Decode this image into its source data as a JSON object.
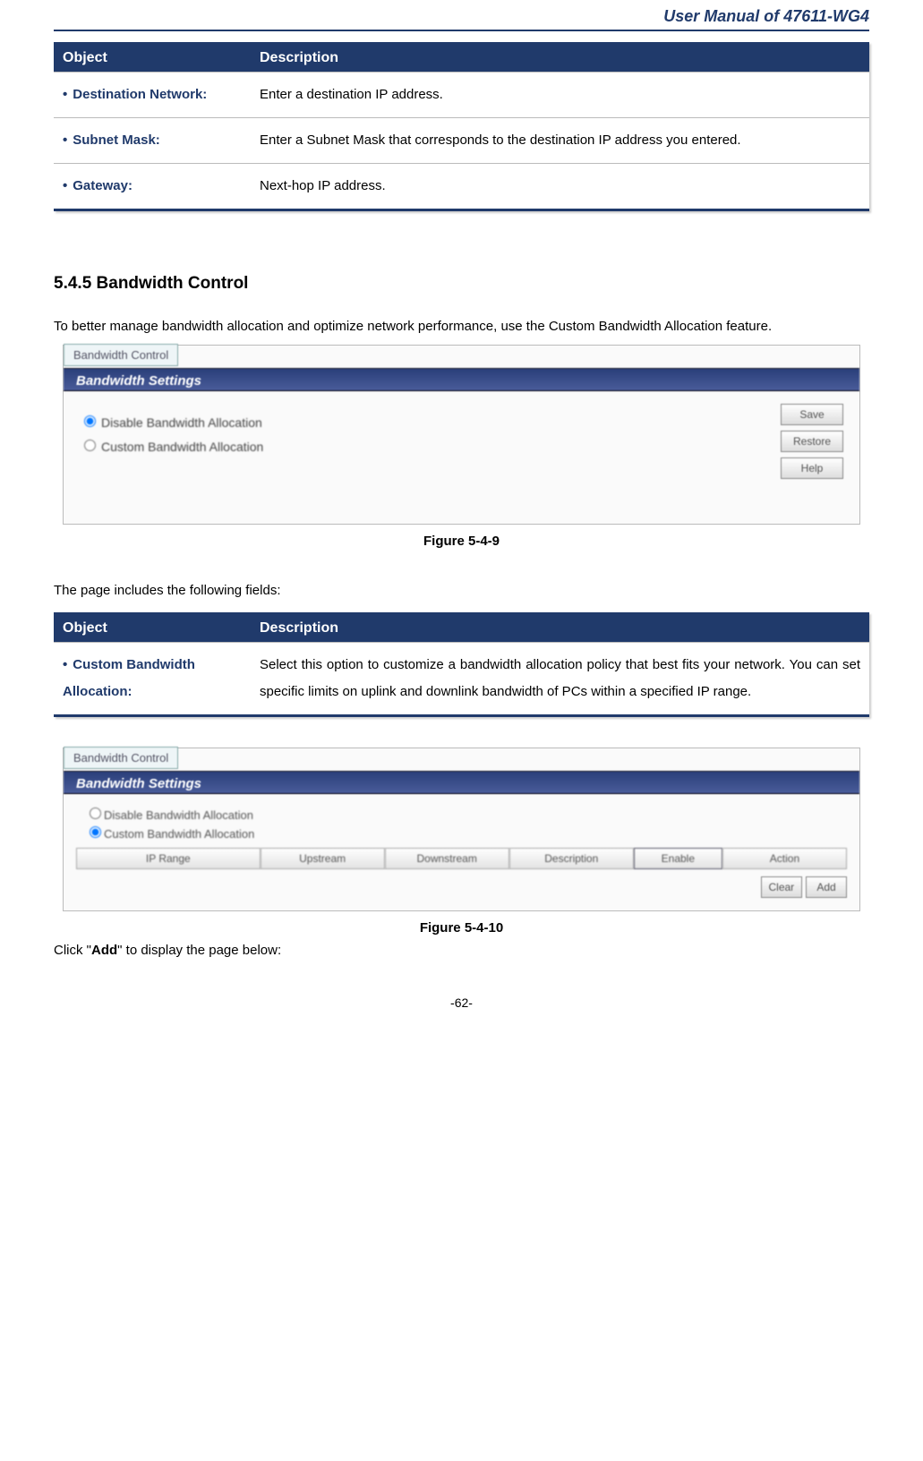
{
  "header": {
    "title": "User Manual of 47611-WG4"
  },
  "table1": {
    "headers": {
      "object": "Object",
      "description": "Description"
    },
    "rows": [
      {
        "object": "Destination Network:",
        "description": "Enter a destination IP address."
      },
      {
        "object": "Subnet Mask:",
        "description": "Enter a Subnet Mask that corresponds to the destination IP address you entered."
      },
      {
        "object": "Gateway:",
        "description": "Next-hop IP address."
      }
    ]
  },
  "section": {
    "heading": "5.4.5   Bandwidth Control",
    "intro": "To better manage bandwidth allocation and optimize network performance, use the Custom Bandwidth Allocation feature."
  },
  "screenshot1": {
    "tab": "Bandwidth Control",
    "titlebar": "Bandwidth Settings",
    "radio_disable": "Disable Bandwidth Allocation",
    "radio_custom": "Custom Bandwidth Allocation",
    "radio_disable_checked": true,
    "radio_custom_checked": false,
    "btn_save": "Save",
    "btn_restore": "Restore",
    "btn_help": "Help"
  },
  "fig1": {
    "caption": "Figure 5-4-9"
  },
  "para2": "The page includes the following fields:",
  "table2": {
    "headers": {
      "object": "Object",
      "description": "Description"
    },
    "rows": [
      {
        "object": "Custom Bandwidth Allocation:",
        "description": "Select this option to customize a bandwidth allocation policy that best fits your network. You can set specific limits on uplink and downlink bandwidth of PCs within a specified IP range."
      }
    ]
  },
  "screenshot2": {
    "tab": "Bandwidth Control",
    "titlebar": "Bandwidth Settings",
    "radio_disable": "Disable Bandwidth Allocation",
    "radio_custom": "Custom Bandwidth Allocation",
    "radio_disable_checked": false,
    "radio_custom_checked": true,
    "cols": [
      "IP Range",
      "Upstream",
      "Downstream",
      "Description",
      "Enable",
      "Action"
    ],
    "btn_clear": "Clear",
    "btn_add": "Add"
  },
  "fig2": {
    "caption": "Figure 5-4-10"
  },
  "para3_prefix": "Click \"",
  "para3_bold": "Add",
  "para3_suffix": "\" to display the page below:",
  "footer": {
    "pagenum": "-62-"
  }
}
